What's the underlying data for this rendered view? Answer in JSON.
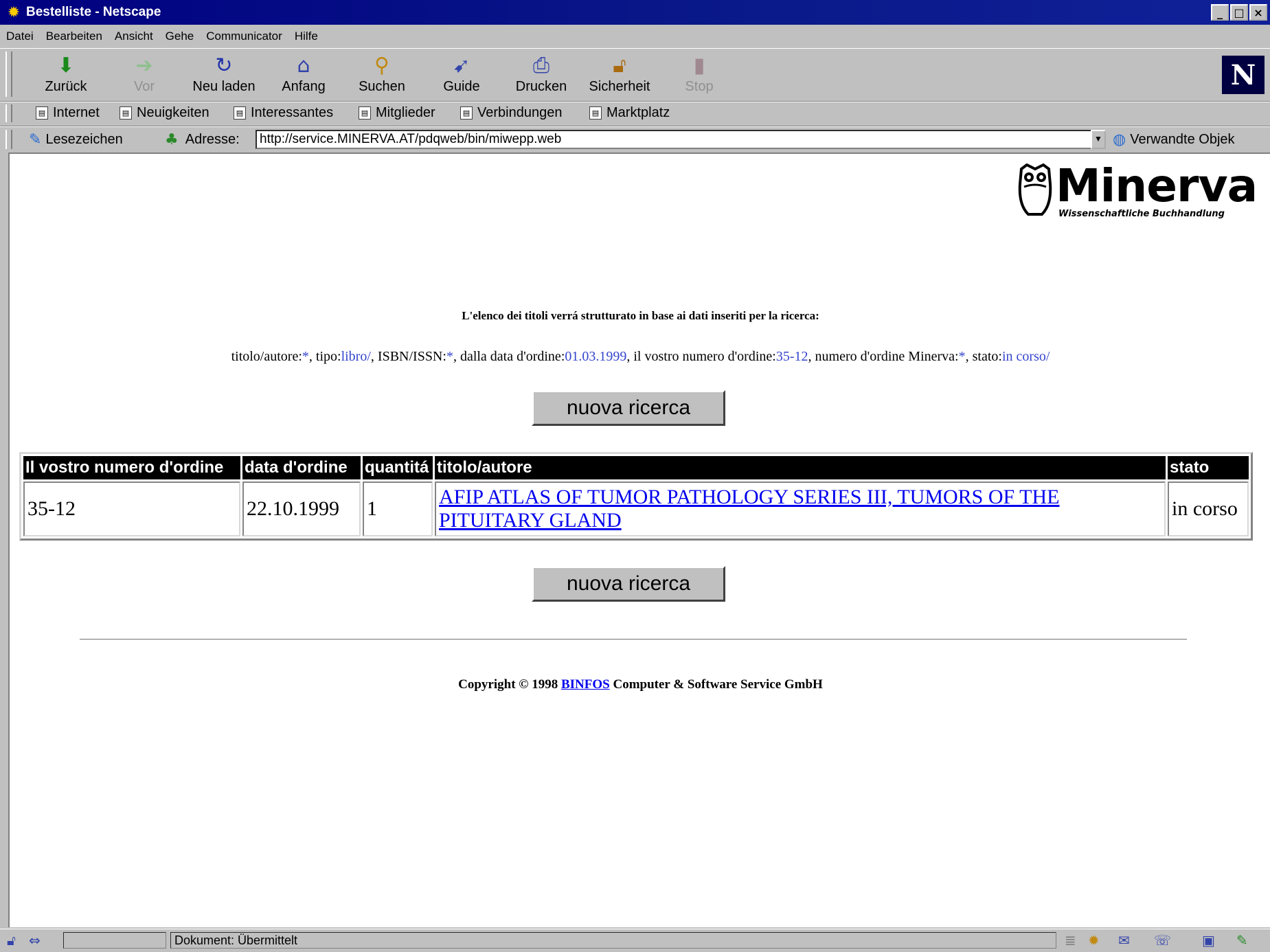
{
  "window": {
    "title": "Bestelliste - Netscape",
    "controls": [
      "_",
      "□",
      "×"
    ]
  },
  "menu": [
    "Datei",
    "Bearbeiten",
    "Ansicht",
    "Gehe",
    "Communicator",
    "Hilfe"
  ],
  "nav_toolbar": [
    {
      "label": "Zurück",
      "icon": "back-arrow-icon",
      "enabled": true
    },
    {
      "label": "Vor",
      "icon": "forward-arrow-icon",
      "enabled": false
    },
    {
      "label": "Neu laden",
      "icon": "reload-icon",
      "enabled": true
    },
    {
      "label": "Anfang",
      "icon": "home-icon",
      "enabled": true
    },
    {
      "label": "Suchen",
      "icon": "search-icon",
      "enabled": true
    },
    {
      "label": "Guide",
      "icon": "guide-icon",
      "enabled": true
    },
    {
      "label": "Drucken",
      "icon": "print-icon",
      "enabled": true
    },
    {
      "label": "Sicherheit",
      "icon": "lock-icon",
      "enabled": true
    },
    {
      "label": "Stop",
      "icon": "stop-icon",
      "enabled": false
    }
  ],
  "brand_logo": "N",
  "personal_toolbar": [
    "Internet",
    "Neuigkeiten",
    "Interessantes",
    "Mitglieder",
    "Verbindungen",
    "Marktplatz"
  ],
  "location": {
    "bookmarks_label": "Lesezeichen",
    "address_label": "Adresse:",
    "url": "http://service.MINERVA.AT/pdqweb/bin/miwepp.web",
    "related_label": "Verwandte Objek"
  },
  "page": {
    "logo_word": "Minerva",
    "logo_sub": "Wissenschaftliche Buchhandlung",
    "lead": "L'elenco dei titoli verrá strutturato in base ai dati inseriti per la ricerca:",
    "criteria": [
      {
        "label": "titolo/autore:",
        "value": "*",
        "sep": ", "
      },
      {
        "label": "tipo:",
        "value": "libro/",
        "sep": ", "
      },
      {
        "label": "ISBN/ISSN:",
        "value": "*",
        "sep": ", "
      },
      {
        "label": "dalla data d'ordine:",
        "value": "01.03.1999",
        "sep": ", "
      },
      {
        "label": "il vostro numero d'ordine:",
        "value": "35-12",
        "sep": ", "
      },
      {
        "label": "numero d'ordine Minerva:",
        "value": "*",
        "sep": ", "
      },
      {
        "label": "stato:",
        "value": "in corso/",
        "sep": ""
      }
    ],
    "new_search_label": "nuova ricerca",
    "table": {
      "headers": [
        "Il vostro numero d'ordine",
        "data d'ordine",
        "quantitá",
        "titolo/autore",
        "stato"
      ],
      "rows": [
        [
          "35-12",
          "22.10.1999",
          "1",
          "AFIP ATLAS OF TUMOR PATHOLOGY SERIES III, TUMORS OF THE PITUITARY GLAND ",
          "in corso"
        ]
      ]
    },
    "copyright": {
      "prefix": "Copyright © 1998 ",
      "link": "BINFOS",
      "suffix": " Computer & Software Service GmbH"
    }
  },
  "status": {
    "text": "Dokument: Übermittelt"
  },
  "colors": {
    "titlebar": "#000080",
    "link": "#0000ee",
    "criteria_value": "#3344cc",
    "chrome": "#c0c0c0"
  }
}
